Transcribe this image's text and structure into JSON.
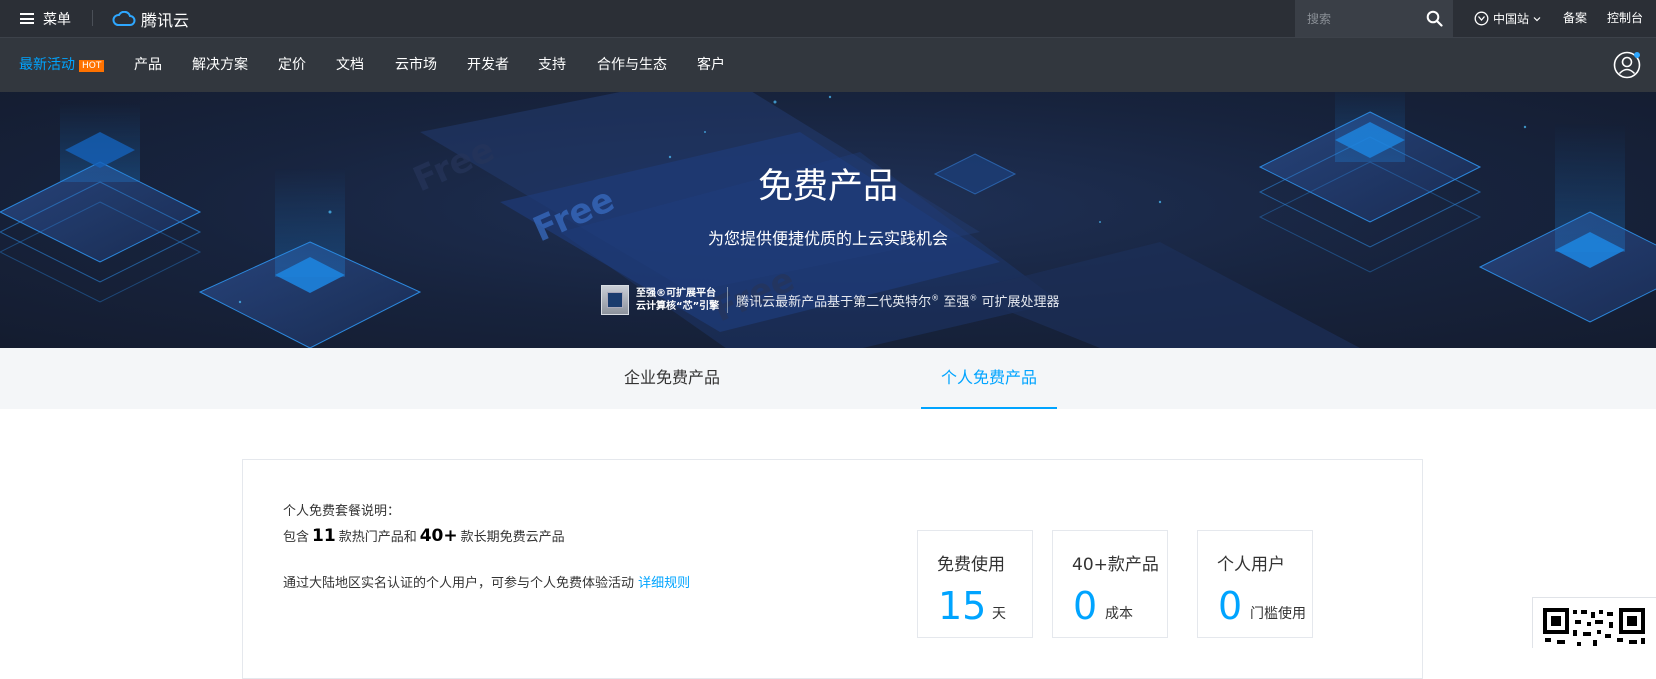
{
  "topbar": {
    "menu_label": "菜单",
    "logo_text": "腾讯云",
    "search_placeholder": "搜索",
    "region_label": "中国站",
    "beian_label": "备案",
    "console_label": "控制台"
  },
  "nav": {
    "items": [
      {
        "label": "最新活动",
        "badge": "HOT"
      },
      {
        "label": "产品"
      },
      {
        "label": "解决方案"
      },
      {
        "label": "定价"
      },
      {
        "label": "文档"
      },
      {
        "label": "云市场"
      },
      {
        "label": "开发者"
      },
      {
        "label": "支持"
      },
      {
        "label": "合作与生态"
      },
      {
        "label": "客户"
      }
    ]
  },
  "hero": {
    "title": "免费产品",
    "subtitle": "为您提供便捷优质的上云实践机会",
    "intel_slogan_line1": "至强®可扩展平台",
    "intel_slogan_line2": "云计算核“芯”引擎",
    "intel_text_a": "腾讯云最新产品基于第二代英特尔",
    "intel_text_b": "至强",
    "intel_text_c": "可扩展处理器",
    "registered_mark": "®"
  },
  "tabs": [
    {
      "label": "企业免费产品",
      "active": false
    },
    {
      "label": "个人免费产品",
      "active": true
    }
  ],
  "content": {
    "desc_title": "个人免费套餐说明：",
    "line_prefix": "包含",
    "hot_count": "11",
    "line_mid": "款热门产品和",
    "long_count": "40+",
    "line_suffix": "款长期免费云产品",
    "note": "通过大陆地区实名认证的个人用户，可参与个人免费体验活动",
    "note_link": "详细规则",
    "stats": [
      {
        "label": "免费使用",
        "value": "15",
        "unit": "天"
      },
      {
        "label": "40+款产品",
        "value": "0",
        "unit": "成本"
      },
      {
        "label": "个人用户",
        "value": "0",
        "unit": "门槛使用"
      }
    ]
  },
  "colors": {
    "accent": "#00a4ff",
    "hot_badge": "#ff7200",
    "topbar_bg": "#2b2f36",
    "nav_bg": "#32373e"
  }
}
